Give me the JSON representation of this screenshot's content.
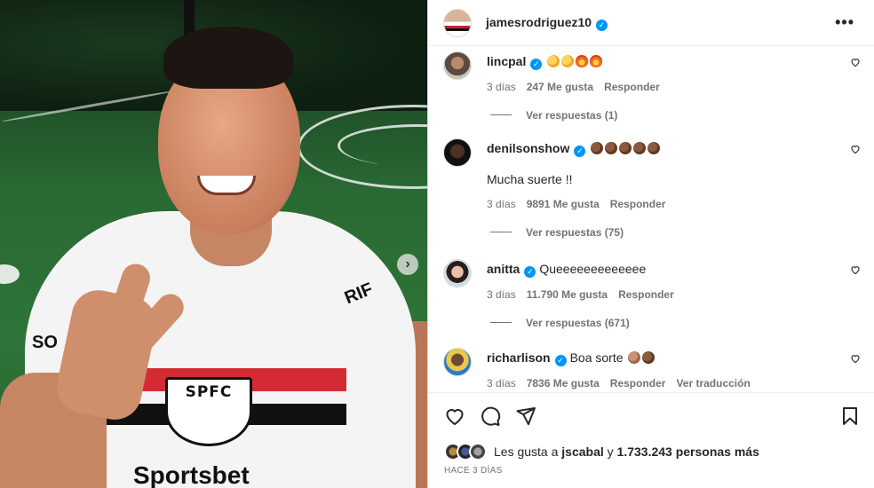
{
  "post": {
    "owner": "jamesrodriguez10",
    "more_icon": "more-horizontal-icon",
    "photo": {
      "jersey_text_crest": "SPFC",
      "jersey_text_sleeve_right": "RIF",
      "jersey_text_sleeve_left": "SO",
      "jersey_text_sponsor": "Sportsbet",
      "next_icon": "chevron-right-icon"
    }
  },
  "comments": [
    {
      "username": "lincpal",
      "verified": true,
      "text": "",
      "emojis": [
        "clap",
        "clap",
        "fire",
        "fire"
      ],
      "extra_text": "",
      "time": "3 días",
      "likes": "247 Me gusta",
      "reply": "Responder",
      "translate": "",
      "view_replies": "Ver respuestas (1)"
    },
    {
      "username": "denilsonshow",
      "verified": true,
      "text": "",
      "emojis": [
        "fist",
        "fist",
        "fist",
        "fist",
        "fist"
      ],
      "extra_text": "Mucha suerte !!",
      "time": "3 días",
      "likes": "9891 Me gusta",
      "reply": "Responder",
      "translate": "",
      "view_replies": "Ver respuestas (75)"
    },
    {
      "username": "anitta",
      "verified": true,
      "text": "Queeeeeeeeeeeee",
      "emojis": [],
      "extra_text": "",
      "time": "3 días",
      "likes": "11.790 Me gusta",
      "reply": "Responder",
      "translate": "",
      "view_replies": "Ver respuestas (671)"
    },
    {
      "username": "richarlison",
      "verified": true,
      "text": "Boa sorte",
      "emojis": [
        "fist-light",
        "fist"
      ],
      "extra_text": "",
      "time": "3 días",
      "likes": "7836 Me gusta",
      "reply": "Responder",
      "translate": "Ver traducción",
      "view_replies": ""
    }
  ],
  "actions": {
    "like_icon": "heart-icon",
    "comment_icon": "comment-icon",
    "share_icon": "send-icon",
    "save_icon": "bookmark-icon"
  },
  "likes_summary": {
    "prefix": "Les gusta a",
    "user": "jscabal",
    "middle": "y",
    "count": "1.733.243 personas más"
  },
  "posted_ago": "HACE 3 DÍAS",
  "colors": {
    "verified": "#0095f6",
    "secondary_text": "#737373",
    "primary_text": "#262626"
  }
}
